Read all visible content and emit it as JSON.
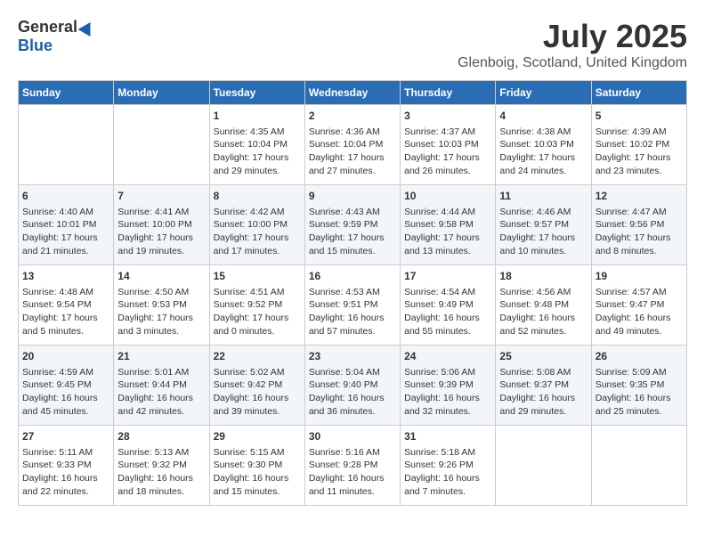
{
  "header": {
    "logo_general": "General",
    "logo_blue": "Blue",
    "month_title": "July 2025",
    "location": "Glenboig, Scotland, United Kingdom"
  },
  "calendar": {
    "days_of_week": [
      "Sunday",
      "Monday",
      "Tuesday",
      "Wednesday",
      "Thursday",
      "Friday",
      "Saturday"
    ],
    "weeks": [
      [
        {
          "day": "",
          "data": ""
        },
        {
          "day": "",
          "data": ""
        },
        {
          "day": "1",
          "data": "Sunrise: 4:35 AM\nSunset: 10:04 PM\nDaylight: 17 hours and 29 minutes."
        },
        {
          "day": "2",
          "data": "Sunrise: 4:36 AM\nSunset: 10:04 PM\nDaylight: 17 hours and 27 minutes."
        },
        {
          "day": "3",
          "data": "Sunrise: 4:37 AM\nSunset: 10:03 PM\nDaylight: 17 hours and 26 minutes."
        },
        {
          "day": "4",
          "data": "Sunrise: 4:38 AM\nSunset: 10:03 PM\nDaylight: 17 hours and 24 minutes."
        },
        {
          "day": "5",
          "data": "Sunrise: 4:39 AM\nSunset: 10:02 PM\nDaylight: 17 hours and 23 minutes."
        }
      ],
      [
        {
          "day": "6",
          "data": "Sunrise: 4:40 AM\nSunset: 10:01 PM\nDaylight: 17 hours and 21 minutes."
        },
        {
          "day": "7",
          "data": "Sunrise: 4:41 AM\nSunset: 10:00 PM\nDaylight: 17 hours and 19 minutes."
        },
        {
          "day": "8",
          "data": "Sunrise: 4:42 AM\nSunset: 10:00 PM\nDaylight: 17 hours and 17 minutes."
        },
        {
          "day": "9",
          "data": "Sunrise: 4:43 AM\nSunset: 9:59 PM\nDaylight: 17 hours and 15 minutes."
        },
        {
          "day": "10",
          "data": "Sunrise: 4:44 AM\nSunset: 9:58 PM\nDaylight: 17 hours and 13 minutes."
        },
        {
          "day": "11",
          "data": "Sunrise: 4:46 AM\nSunset: 9:57 PM\nDaylight: 17 hours and 10 minutes."
        },
        {
          "day": "12",
          "data": "Sunrise: 4:47 AM\nSunset: 9:56 PM\nDaylight: 17 hours and 8 minutes."
        }
      ],
      [
        {
          "day": "13",
          "data": "Sunrise: 4:48 AM\nSunset: 9:54 PM\nDaylight: 17 hours and 5 minutes."
        },
        {
          "day": "14",
          "data": "Sunrise: 4:50 AM\nSunset: 9:53 PM\nDaylight: 17 hours and 3 minutes."
        },
        {
          "day": "15",
          "data": "Sunrise: 4:51 AM\nSunset: 9:52 PM\nDaylight: 17 hours and 0 minutes."
        },
        {
          "day": "16",
          "data": "Sunrise: 4:53 AM\nSunset: 9:51 PM\nDaylight: 16 hours and 57 minutes."
        },
        {
          "day": "17",
          "data": "Sunrise: 4:54 AM\nSunset: 9:49 PM\nDaylight: 16 hours and 55 minutes."
        },
        {
          "day": "18",
          "data": "Sunrise: 4:56 AM\nSunset: 9:48 PM\nDaylight: 16 hours and 52 minutes."
        },
        {
          "day": "19",
          "data": "Sunrise: 4:57 AM\nSunset: 9:47 PM\nDaylight: 16 hours and 49 minutes."
        }
      ],
      [
        {
          "day": "20",
          "data": "Sunrise: 4:59 AM\nSunset: 9:45 PM\nDaylight: 16 hours and 45 minutes."
        },
        {
          "day": "21",
          "data": "Sunrise: 5:01 AM\nSunset: 9:44 PM\nDaylight: 16 hours and 42 minutes."
        },
        {
          "day": "22",
          "data": "Sunrise: 5:02 AM\nSunset: 9:42 PM\nDaylight: 16 hours and 39 minutes."
        },
        {
          "day": "23",
          "data": "Sunrise: 5:04 AM\nSunset: 9:40 PM\nDaylight: 16 hours and 36 minutes."
        },
        {
          "day": "24",
          "data": "Sunrise: 5:06 AM\nSunset: 9:39 PM\nDaylight: 16 hours and 32 minutes."
        },
        {
          "day": "25",
          "data": "Sunrise: 5:08 AM\nSunset: 9:37 PM\nDaylight: 16 hours and 29 minutes."
        },
        {
          "day": "26",
          "data": "Sunrise: 5:09 AM\nSunset: 9:35 PM\nDaylight: 16 hours and 25 minutes."
        }
      ],
      [
        {
          "day": "27",
          "data": "Sunrise: 5:11 AM\nSunset: 9:33 PM\nDaylight: 16 hours and 22 minutes."
        },
        {
          "day": "28",
          "data": "Sunrise: 5:13 AM\nSunset: 9:32 PM\nDaylight: 16 hours and 18 minutes."
        },
        {
          "day": "29",
          "data": "Sunrise: 5:15 AM\nSunset: 9:30 PM\nDaylight: 16 hours and 15 minutes."
        },
        {
          "day": "30",
          "data": "Sunrise: 5:16 AM\nSunset: 9:28 PM\nDaylight: 16 hours and 11 minutes."
        },
        {
          "day": "31",
          "data": "Sunrise: 5:18 AM\nSunset: 9:26 PM\nDaylight: 16 hours and 7 minutes."
        },
        {
          "day": "",
          "data": ""
        },
        {
          "day": "",
          "data": ""
        }
      ]
    ]
  }
}
